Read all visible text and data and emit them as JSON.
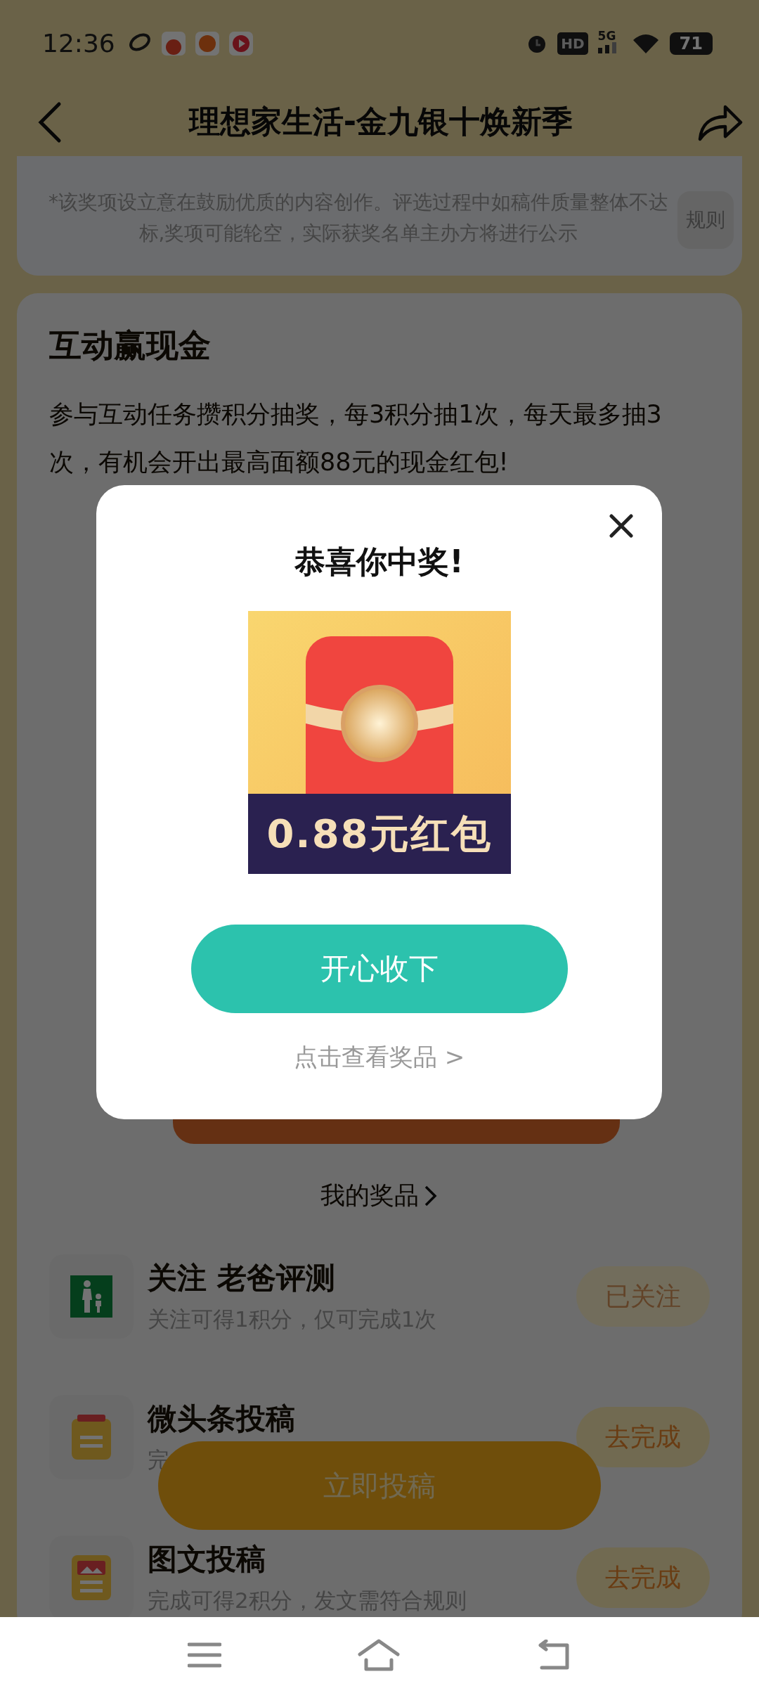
{
  "status_bar": {
    "time": "12:36",
    "hd": "HD",
    "network": "5G",
    "battery": "71"
  },
  "header": {
    "title": "理想家生活-金九银十焕新季"
  },
  "notice": {
    "text": "*该奖项设立意在鼓励优质的内容创作。评选过程中如稿件质量整体不达标,奖项可能轮空，实际获奖名单主办方将进行公示",
    "rules_button": "规则"
  },
  "section": {
    "title": "互动赢现金",
    "description": "参与互动任务攒积分抽奖，每3积分抽1次，每天最多抽3次，有机会开出最高面额88元的现金红包!"
  },
  "my_prizes": "我的奖品",
  "tasks": [
    {
      "kind": "follow",
      "title": "关注 老爸评测",
      "subtitle": "关注可得1积分，仅可完成1次",
      "button": "已关注",
      "done": true
    },
    {
      "kind": "post",
      "title": "微头条投稿",
      "subtitle": "完",
      "button": "去完成",
      "done": false
    },
    {
      "kind": "article",
      "title": "图文投稿",
      "subtitle": "完成可得2积分，发文需符合规则",
      "button": "去完成",
      "done": false
    }
  ],
  "floating_button": "立即投稿",
  "modal": {
    "title": "恭喜你中奖!",
    "prize_label": "0.88元红包",
    "confirm_button": "开心收下",
    "view_link": "点击查看奖品 >"
  }
}
